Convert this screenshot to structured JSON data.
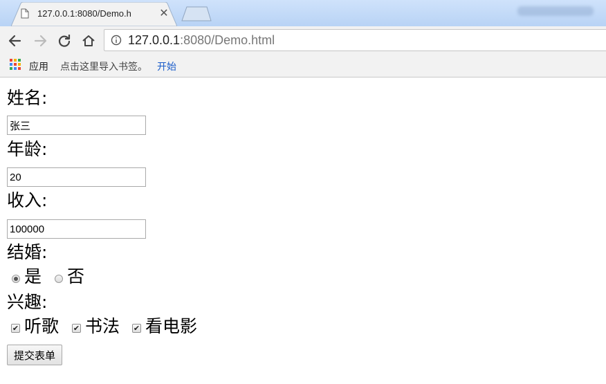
{
  "browser": {
    "tab_title": "127.0.0.1:8080/Demo.h",
    "url_host": "127.0.0.1",
    "url_rest": ":8080/Demo.html",
    "bookmarks": {
      "apps_label": "应用",
      "import_hint": "点击这里导入书签。",
      "start_link": "开始"
    }
  },
  "form": {
    "name_label": "姓名:",
    "name_value": "张三",
    "age_label": "年龄:",
    "age_value": "20",
    "income_label": "收入:",
    "income_value": "100000",
    "married_label": "结婚:",
    "married_options": [
      {
        "label": "是",
        "checked": true
      },
      {
        "label": "否",
        "checked": false
      }
    ],
    "hobby_label": "兴趣:",
    "hobbies": [
      {
        "label": "听歌",
        "checked": true
      },
      {
        "label": "书法",
        "checked": true
      },
      {
        "label": "看电影",
        "checked": true
      }
    ],
    "submit_label": "提交表单"
  },
  "icons": {
    "tab_favicon": "document-icon",
    "tab_close": "close-icon",
    "back": "arrow-left-icon",
    "forward": "arrow-right-icon",
    "reload": "reload-icon",
    "home": "home-icon",
    "info": "info-icon",
    "apps": "apps-grid-icon",
    "check_glyph": "✔"
  }
}
